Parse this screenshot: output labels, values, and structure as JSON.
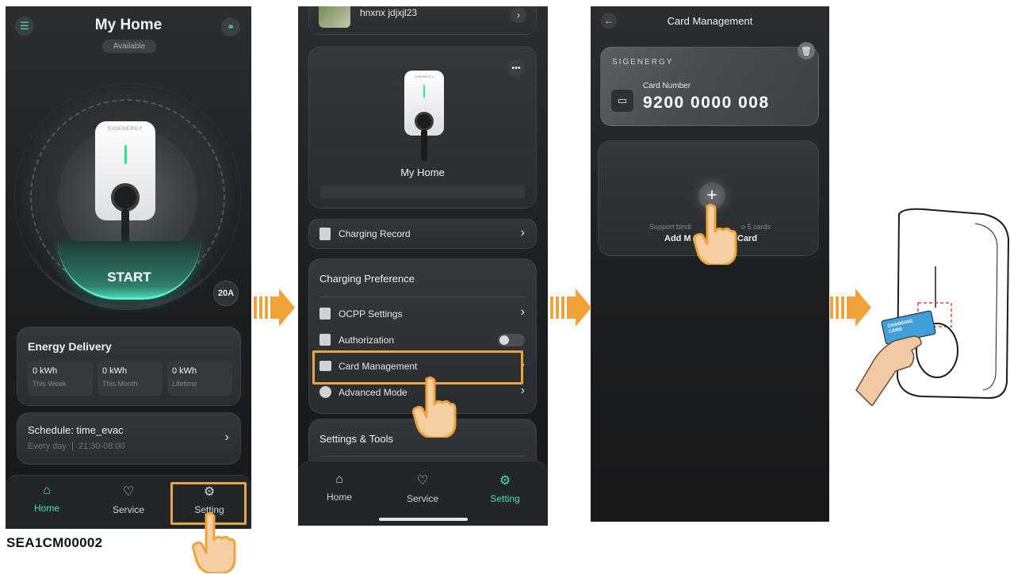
{
  "screen1": {
    "title": "My Home",
    "status": "Available",
    "start_label": "START",
    "current_badge": "20A",
    "energy": {
      "title": "Energy Delivery",
      "stats": [
        {
          "value": "0 kWh",
          "label": "This Week"
        },
        {
          "value": "0 kWh",
          "label": "This Month"
        },
        {
          "value": "0 kWh",
          "label": "Lifetime"
        }
      ]
    },
    "schedule": {
      "title": "Schedule: time_evac",
      "subtitle": "Every day  |  21:30-08:00"
    },
    "nav": [
      {
        "label": "Home",
        "icon": "home-icon",
        "active": true
      },
      {
        "label": "Service",
        "icon": "service-icon",
        "active": false
      },
      {
        "label": "Setting",
        "icon": "gear-icon",
        "active": false
      }
    ]
  },
  "screen2": {
    "top_item": "hnxnx jdjxjl23",
    "device_name": "My Home",
    "charging_record": "Charging Record",
    "preference_title": "Charging Preference",
    "preference_items": [
      {
        "label": "OCPP Settings",
        "icon": "ocpp-settings-icon",
        "control": "chevron"
      },
      {
        "label": "Authorization",
        "icon": "authorization-icon",
        "control": "toggle"
      },
      {
        "label": "Card Management",
        "icon": "card-management-icon",
        "control": "chevron"
      },
      {
        "label": "Advanced Mode",
        "icon": "advanced-mode-icon",
        "control": "chevron"
      }
    ],
    "settings_tools_title": "Settings & Tools",
    "nav": [
      {
        "label": "Home",
        "icon": "home-icon",
        "active": false
      },
      {
        "label": "Service",
        "icon": "service-icon",
        "active": false
      },
      {
        "label": "Setting",
        "icon": "gear-icon",
        "active": true
      }
    ]
  },
  "screen3": {
    "title": "Card Management",
    "brand": "SIGENERGY",
    "card_number_label": "Card Number",
    "card_number": "9200 0000 008",
    "support_text_left": "Support bindi",
    "support_text_right": "o 5 cards",
    "add_text_left": "Add M",
    "add_text_right": "Card"
  },
  "device_photo": {
    "card_text": "CHARGING CARD"
  },
  "model_code": "SEA1CM00002",
  "colors": {
    "accent": "#3fe0b8",
    "highlight": "#e9a540",
    "arrow": "#efa33a",
    "background": "#1c1f21"
  }
}
